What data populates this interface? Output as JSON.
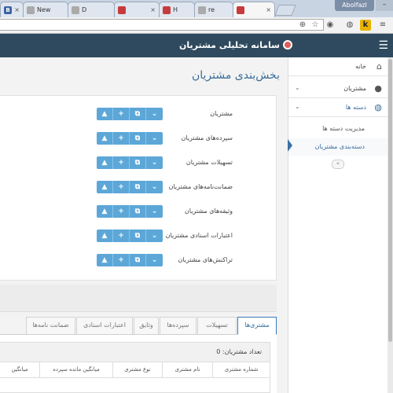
{
  "browser": {
    "tabs": [
      {
        "title": "",
        "icon": "blogger-icon"
      },
      {
        "title": "New",
        "icon": "blank-page-icon"
      },
      {
        "title": "D",
        "icon": "page-icon"
      },
      {
        "title": "",
        "icon": "app-icon"
      },
      {
        "title": "H",
        "icon": "app-icon"
      },
      {
        "title": "re",
        "icon": "page-icon"
      },
      {
        "title": "",
        "icon": "app-icon"
      }
    ],
    "profile_name": "Abolfazl",
    "close_glyph": "×"
  },
  "app": {
    "title": "سامانه تحلیلی مشتریان"
  },
  "sidebar": {
    "items": [
      {
        "label": "خانه",
        "icon": "home-icon"
      },
      {
        "label": "مشتریان",
        "icon": "user-icon"
      },
      {
        "label": "دسته ها",
        "icon": "users-icon"
      }
    ],
    "subitems": [
      {
        "label": "مدیریت دسته ها"
      },
      {
        "label": "دسته‌بندی مشتریان",
        "active": true
      }
    ]
  },
  "main": {
    "page_title": "بخش‌بندی مشتریان",
    "rows": [
      {
        "label": "مشتریان"
      },
      {
        "label": "سپرده‌های مشتریان"
      },
      {
        "label": "تسهیلات مشتریان"
      },
      {
        "label": "ضمانت‌نامه‌های مشتریان"
      },
      {
        "label": "وثیقه‌های مشتریان"
      },
      {
        "label": "اعتبارات اسنادی مشتریان"
      },
      {
        "label": "تراکنش‌های مشتریان"
      }
    ],
    "row_buttons": {
      "dropdown": "⌄",
      "copy": "⧉",
      "add": "+",
      "warning": "▲"
    },
    "tabs": [
      {
        "label": "مشتری‌ها",
        "active": true
      },
      {
        "label": "تسهیلات"
      },
      {
        "label": "سپرده‌ها"
      },
      {
        "label": "وثایق"
      },
      {
        "label": "اعتبارات اسنادی"
      },
      {
        "label": "ضمانت نامه‌ها"
      }
    ],
    "count_label": "تعداد مشتریان: 0",
    "columns": [
      "شماره مشتری",
      "نام مشتری",
      "نوع مشتری",
      "میانگین مانده سپرده",
      "میانگین"
    ]
  },
  "colors": {
    "header_bg": "#2f4a5e",
    "accent": "#3a6d9c",
    "button": "#5ca7d8"
  }
}
